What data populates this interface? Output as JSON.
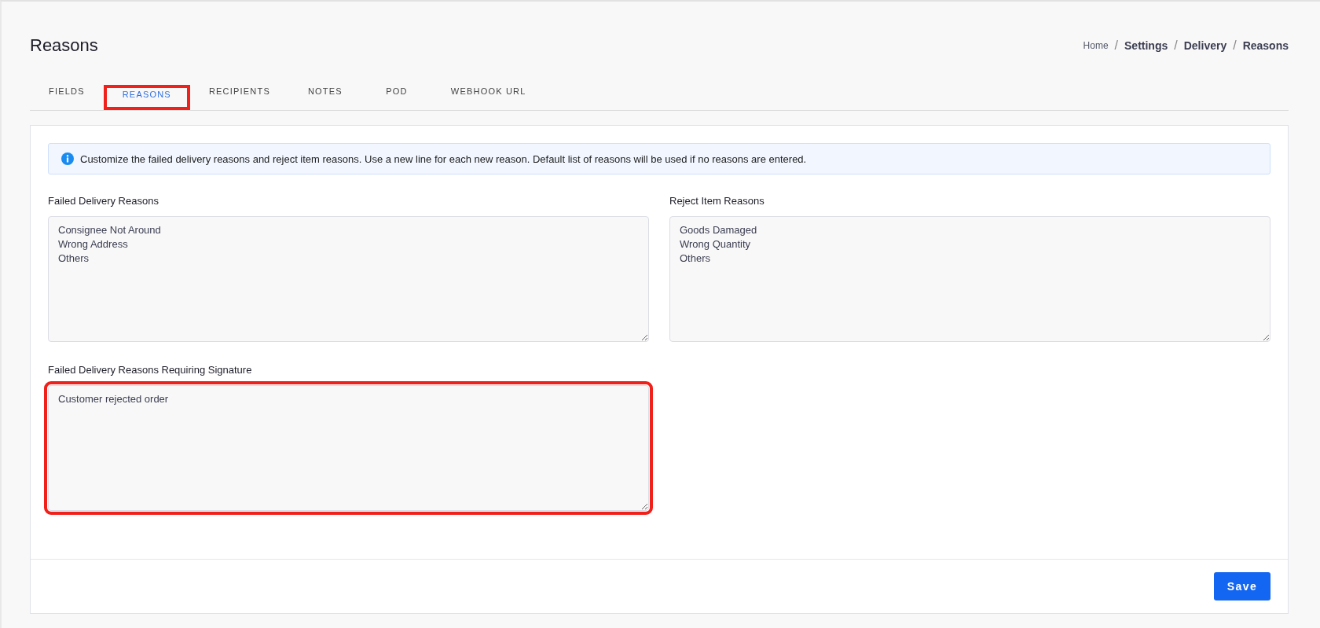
{
  "page_title": "Reasons",
  "breadcrumb": [
    {
      "label": "Home",
      "current": false
    },
    {
      "label": "Settings",
      "current": true
    },
    {
      "label": "Delivery",
      "current": true
    },
    {
      "label": "Reasons",
      "current": true
    }
  ],
  "breadcrumb_separator": "/",
  "tabs": [
    {
      "label": "FIELDS",
      "selected": false,
      "highlighted": false
    },
    {
      "label": "REASONS",
      "selected": true,
      "highlighted": true
    },
    {
      "label": "RECIPIENTS",
      "selected": false,
      "highlighted": false
    },
    {
      "label": "NOTES",
      "selected": false,
      "highlighted": false
    },
    {
      "label": "POD",
      "selected": false,
      "highlighted": false
    },
    {
      "label": "WEBHOOK URL",
      "selected": false,
      "highlighted": false
    }
  ],
  "info_alert": {
    "text": "Customize the failed delivery reasons and reject item reasons. Use a new line for each new reason. Default list of reasons will be used if no reasons are entered."
  },
  "fields": [
    {
      "label": "Failed Delivery Reasons",
      "value": "Consignee Not Around\nWrong Address\nOthers",
      "highlighted": false
    },
    {
      "label": "Reject Item Reasons",
      "value": "Goods Damaged\nWrong Quantity\nOthers",
      "highlighted": false
    },
    {
      "label": "Failed Delivery Reasons Requiring Signature",
      "value": "Customer rejected order",
      "highlighted": true
    }
  ],
  "save_button": "Save"
}
